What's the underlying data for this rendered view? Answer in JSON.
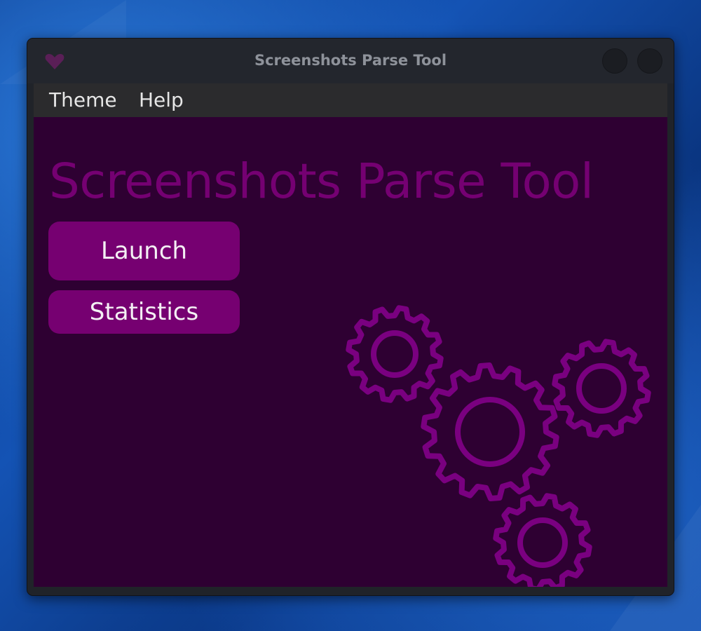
{
  "window": {
    "title": "Screenshots Parse Tool"
  },
  "menubar": {
    "items": [
      {
        "label": "Theme"
      },
      {
        "label": "Help"
      }
    ]
  },
  "main": {
    "heading": "Screenshots Parse Tool",
    "launch_label": "Launch",
    "statistics_label": "Statistics"
  },
  "icons": {
    "app_logo": "heart-icon",
    "illustration": "gears-icon"
  },
  "colors": {
    "content_background": "#2e0032",
    "accent": "#760071",
    "gear_stroke": "#7a0080",
    "titlebar": "#23262d",
    "menubar": "#2b2b2d"
  }
}
